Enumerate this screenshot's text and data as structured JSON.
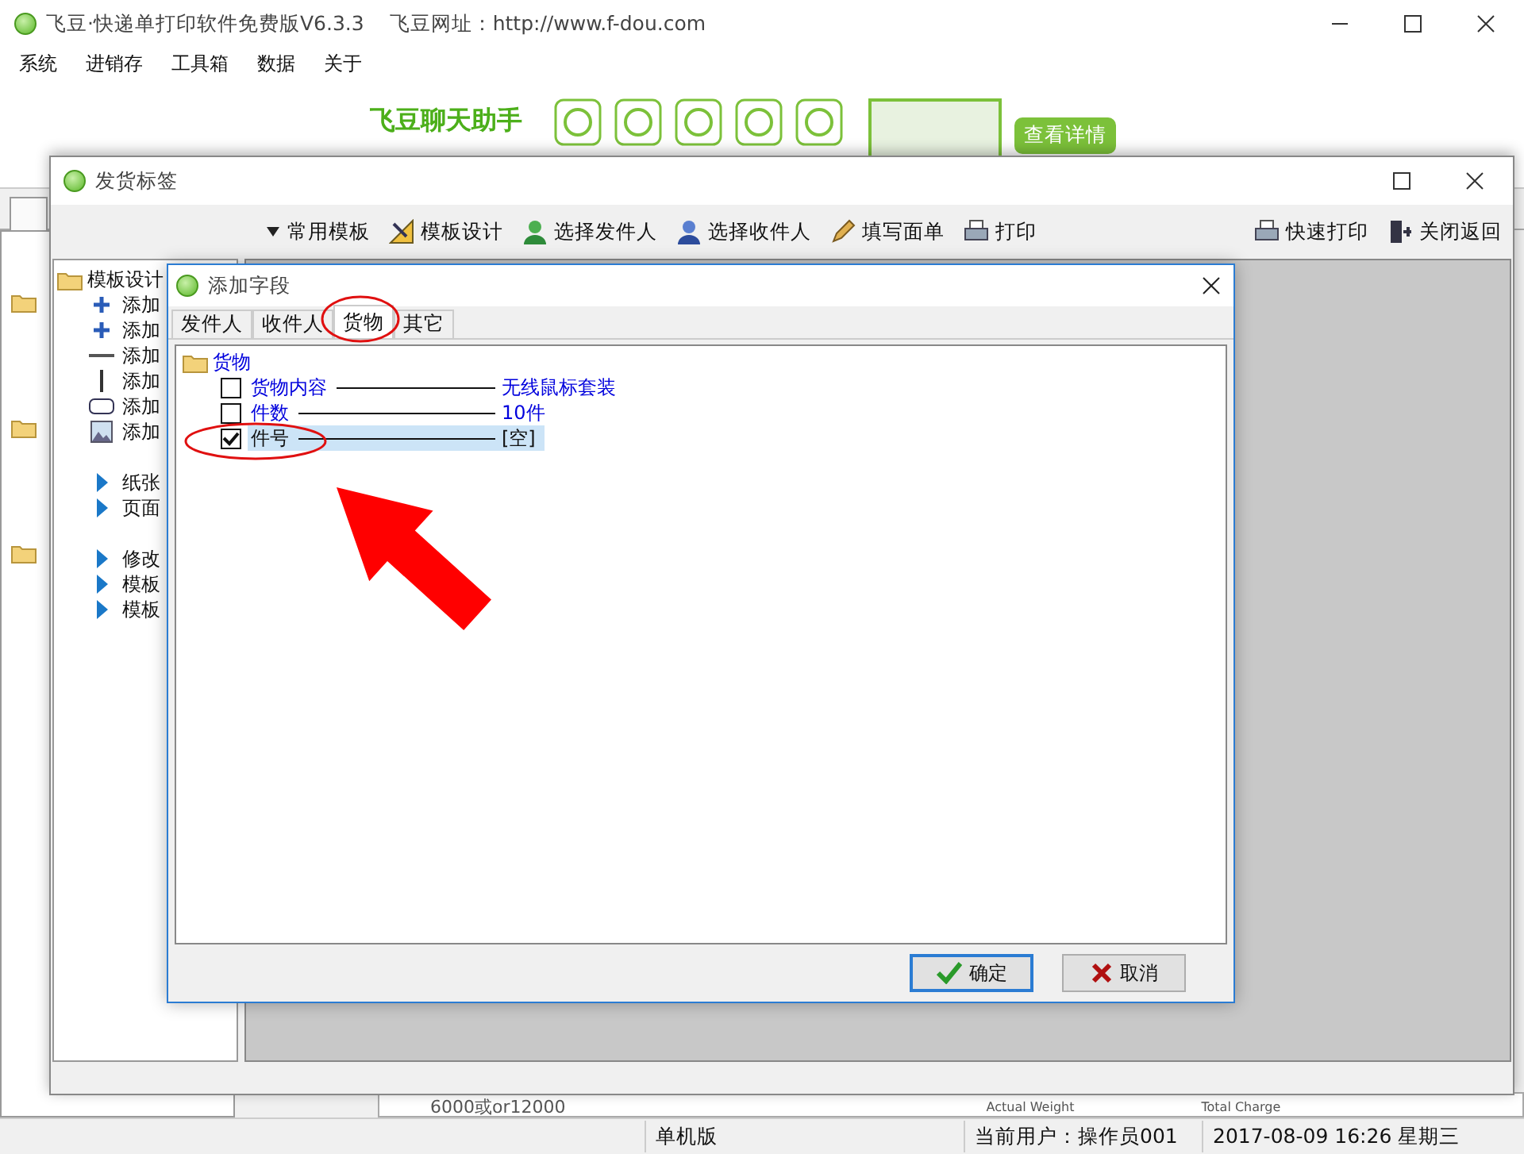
{
  "window": {
    "title": "飞豆·快递单打印软件免费版V6.3.3",
    "url": "飞豆网址：http://www.f-dou.com"
  },
  "menu": [
    "系统",
    "进销存",
    "工具箱",
    "数据",
    "关于"
  ],
  "banner": {
    "title": "飞豆聊天助手",
    "button": "查看详情"
  },
  "child_window": {
    "title": "发货标签",
    "toolbar": [
      {
        "label": "常用模板",
        "kind": "dropdown"
      },
      {
        "label": "模板设计",
        "kind": "design"
      },
      {
        "label": "选择发件人",
        "kind": "sender"
      },
      {
        "label": "选择收件人",
        "kind": "receiver"
      },
      {
        "label": "填写面单",
        "kind": "pencil"
      },
      {
        "label": "打印",
        "kind": "printer"
      }
    ],
    "toolbar_right": [
      {
        "label": "快速打印",
        "kind": "printer"
      },
      {
        "label": "关闭返回",
        "kind": "exit"
      }
    ],
    "panel_groups": [
      [
        {
          "label": "模板设计",
          "kind": "folder"
        },
        {
          "label": "添加",
          "kind": "plus"
        },
        {
          "label": "添加",
          "kind": "plus"
        },
        {
          "label": "添加",
          "kind": "hline"
        },
        {
          "label": "添加",
          "kind": "vline"
        },
        {
          "label": "添加",
          "kind": "rect"
        },
        {
          "label": "添加",
          "kind": "image"
        }
      ],
      [
        {
          "label": "纸张",
          "kind": "arrow"
        },
        {
          "label": "页面",
          "kind": "arrow"
        }
      ],
      [
        {
          "label": "修改",
          "kind": "arrow"
        },
        {
          "label": "模板",
          "kind": "arrow"
        },
        {
          "label": "模板",
          "kind": "arrow"
        }
      ]
    ]
  },
  "dialog": {
    "title": "添加字段",
    "tabs": [
      {
        "label": "发件人",
        "selected": false
      },
      {
        "label": "收件人",
        "selected": false
      },
      {
        "label": "货物",
        "selected": true
      },
      {
        "label": "其它",
        "selected": false
      }
    ],
    "tree": {
      "label": "货物",
      "children": [
        {
          "label": "货物内容",
          "value": "无线鼠标套装",
          "checked": false,
          "selected": false
        },
        {
          "label": "件数",
          "value": "10件",
          "checked": false,
          "selected": false
        },
        {
          "label": "件号",
          "value": "[空]",
          "checked": true,
          "selected": true
        }
      ]
    },
    "buttons": [
      {
        "label": "确定",
        "kind": "ok"
      },
      {
        "label": "取消",
        "kind": "cancel"
      }
    ]
  },
  "background_template": [
    "6000或or12000",
    "Actual Weight",
    "Total Charge"
  ],
  "status_bar": [
    "单机版",
    "当前用户：操作员001",
    "2017-08-09 16:26 星期三"
  ]
}
